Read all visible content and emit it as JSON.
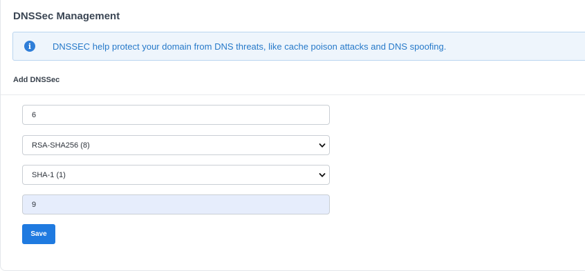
{
  "page": {
    "title": "DNSSec Management"
  },
  "alert": {
    "icon": "info-icon",
    "text": "DNSSEC help protect your domain from DNS threats, like cache poison attacks and DNS spoofing."
  },
  "form": {
    "section_label": "Add DNSSec",
    "key_tag_value": "6",
    "algorithm": {
      "selected": "RSA-SHA256 (8)"
    },
    "digest_type": {
      "selected": "SHA-1 (1)"
    },
    "digest_value": "9",
    "save_label": "Save"
  },
  "colors": {
    "accent": "#1f7ae0",
    "alert_background": "#eef5fc",
    "alert_text": "#2679c9",
    "autofill_background": "#e6edfc"
  }
}
